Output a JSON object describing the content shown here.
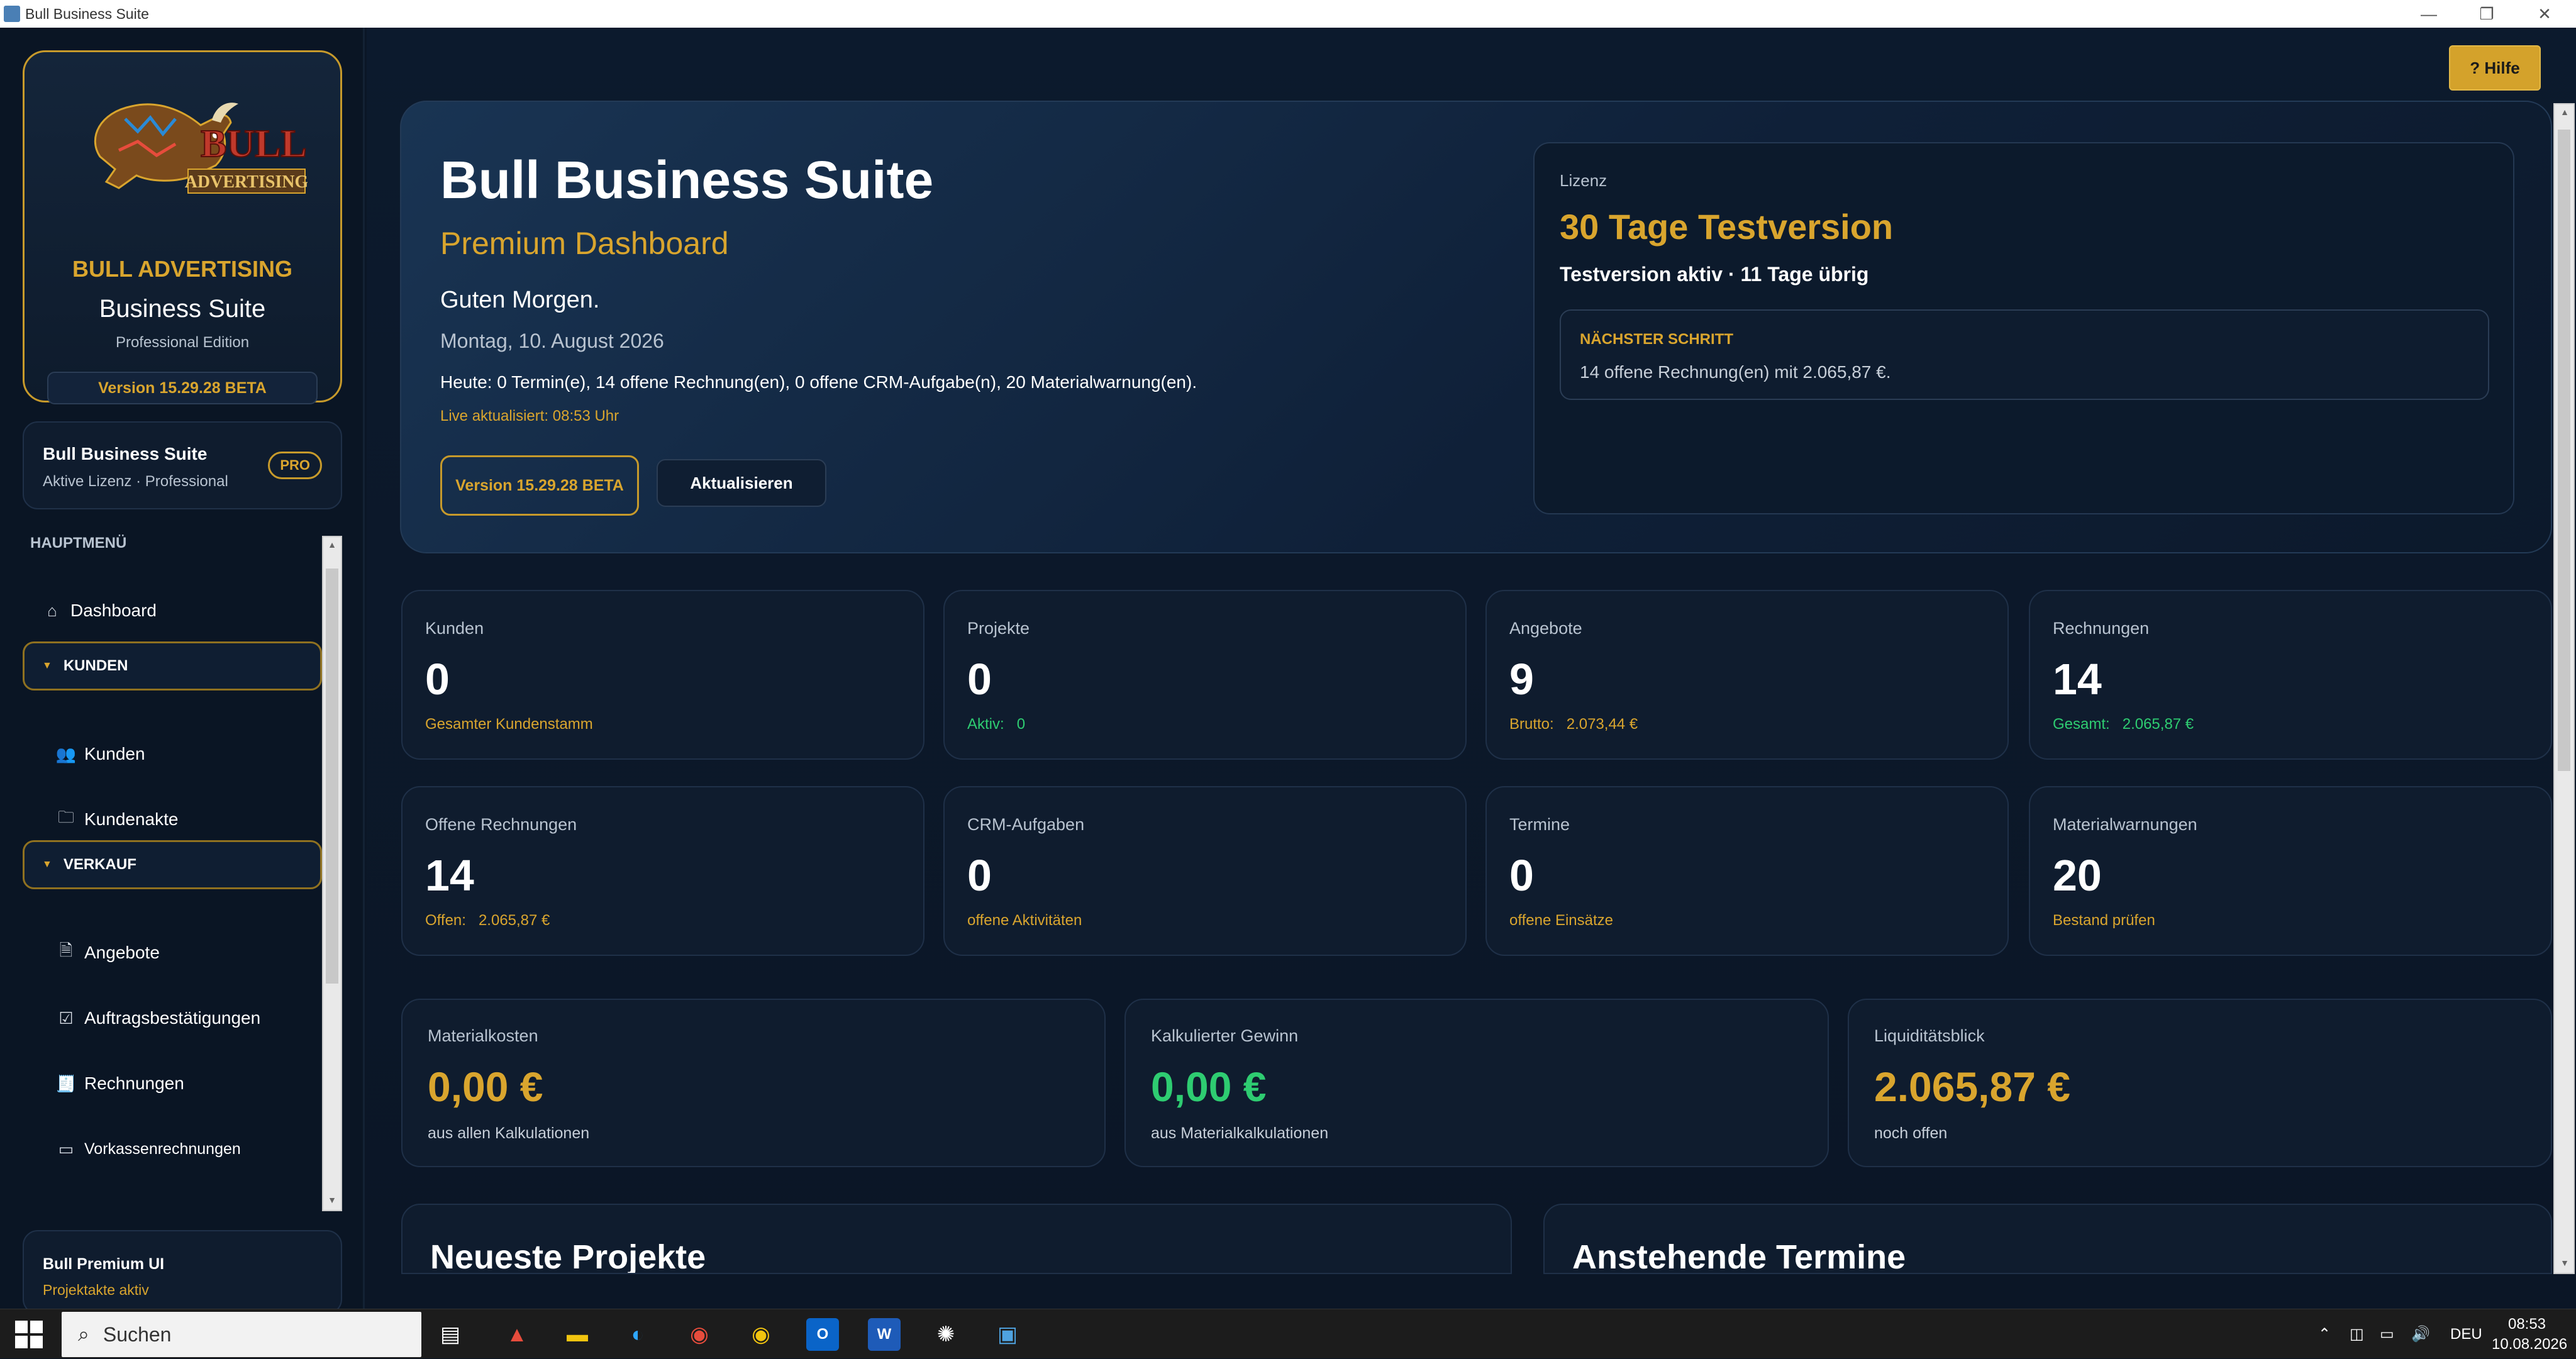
{
  "window": {
    "title": "Bull Business Suite",
    "minimize": "—",
    "restore": "❐",
    "close": "✕"
  },
  "brand": {
    "logo_text_top": "BULL",
    "logo_text_bottom": "ADVERTISING",
    "name": "BULL ADVERTISING",
    "product": "Business Suite",
    "edition": "Professional Edition",
    "version": "Version 15.29.28 BETA"
  },
  "license_card": {
    "title": "Bull Business Suite",
    "subtitle": "Aktive Lizenz · Professional",
    "badge": "PRO"
  },
  "menu": {
    "heading": "HAUPTMENÜ",
    "dashboard": "Dashboard",
    "section_kunden": "KUNDEN",
    "kunden": "Kunden",
    "kundenakte": "Kundenakte",
    "section_verkauf": "VERKAUF",
    "angebote": "Angebote",
    "auftragsbestaetigungen": "Auftragsbestätigungen",
    "rechnungen": "Rechnungen",
    "vorkassenrechnungen": "Vorkassenrechnungen"
  },
  "footer_card": {
    "title": "Bull Premium UI",
    "subtitle": "Projektakte aktiv"
  },
  "help_button": "? Hilfe",
  "hero": {
    "title": "Bull Business Suite",
    "subtitle": "Premium Dashboard",
    "greeting": "Guten Morgen.",
    "date": "Montag, 10. August 2026",
    "today": "Heute: 0 Termin(e), 14 offene Rechnung(en), 0 offene CRM-Aufgabe(n), 20 Materialwarnung(en).",
    "live": "Live aktualisiert: 08:53 Uhr",
    "version_button": "Version 15.29.28 BETA",
    "refresh_button": "Aktualisieren"
  },
  "lizenz": {
    "label": "Lizenz",
    "title": "30 Tage Testversion",
    "status": "Testversion aktiv · 11 Tage übrig",
    "next_heading": "NÄCHSTER SCHRITT",
    "next_text": "14 offene Rechnung(en) mit 2.065,87 €."
  },
  "stats": [
    {
      "label": "Kunden",
      "value": "0",
      "sub": "Gesamter Kundenstamm",
      "sub_key": "",
      "sub_val": ""
    },
    {
      "label": "Projekte",
      "value": "0",
      "sub": "",
      "sub_key": "Aktiv:",
      "sub_val": "0"
    },
    {
      "label": "Angebote",
      "value": "9",
      "sub": "",
      "sub_key": "Brutto:",
      "sub_val": "2.073,44 €"
    },
    {
      "label": "Rechnungen",
      "value": "14",
      "sub": "",
      "sub_key": "Gesamt:",
      "sub_val": "2.065,87 €"
    },
    {
      "label": "Offene Rechnungen",
      "value": "14",
      "sub": "",
      "sub_key": "Offen:",
      "sub_val": "2.065,87 €"
    },
    {
      "label": "CRM-Aufgaben",
      "value": "0",
      "sub": "offene Aktivitäten",
      "sub_key": "",
      "sub_val": ""
    },
    {
      "label": "Termine",
      "value": "0",
      "sub": "offene Einsätze",
      "sub_key": "",
      "sub_val": ""
    },
    {
      "label": "Materialwarnungen",
      "value": "20",
      "sub": "Bestand prüfen",
      "sub_key": "",
      "sub_val": ""
    }
  ],
  "finance": [
    {
      "label": "Materialkosten",
      "value": "0,00 €",
      "sub": "aus allen Kalkulationen",
      "color": "#d9a52e"
    },
    {
      "label": "Kalkulierter Gewinn",
      "value": "0,00 €",
      "sub": "aus Materialkalkulationen",
      "color": "#2ecc71"
    },
    {
      "label": "Liquiditätsblick",
      "value": "2.065,87 €",
      "sub": "noch offen",
      "color": "#d9a52e"
    }
  ],
  "panels": {
    "projects": "Neueste Projekte",
    "appointments": "Anstehende Termine"
  },
  "taskbar": {
    "search_placeholder": "Suchen",
    "language": "DEU",
    "time": "08:53",
    "date": "10.08.2026"
  }
}
